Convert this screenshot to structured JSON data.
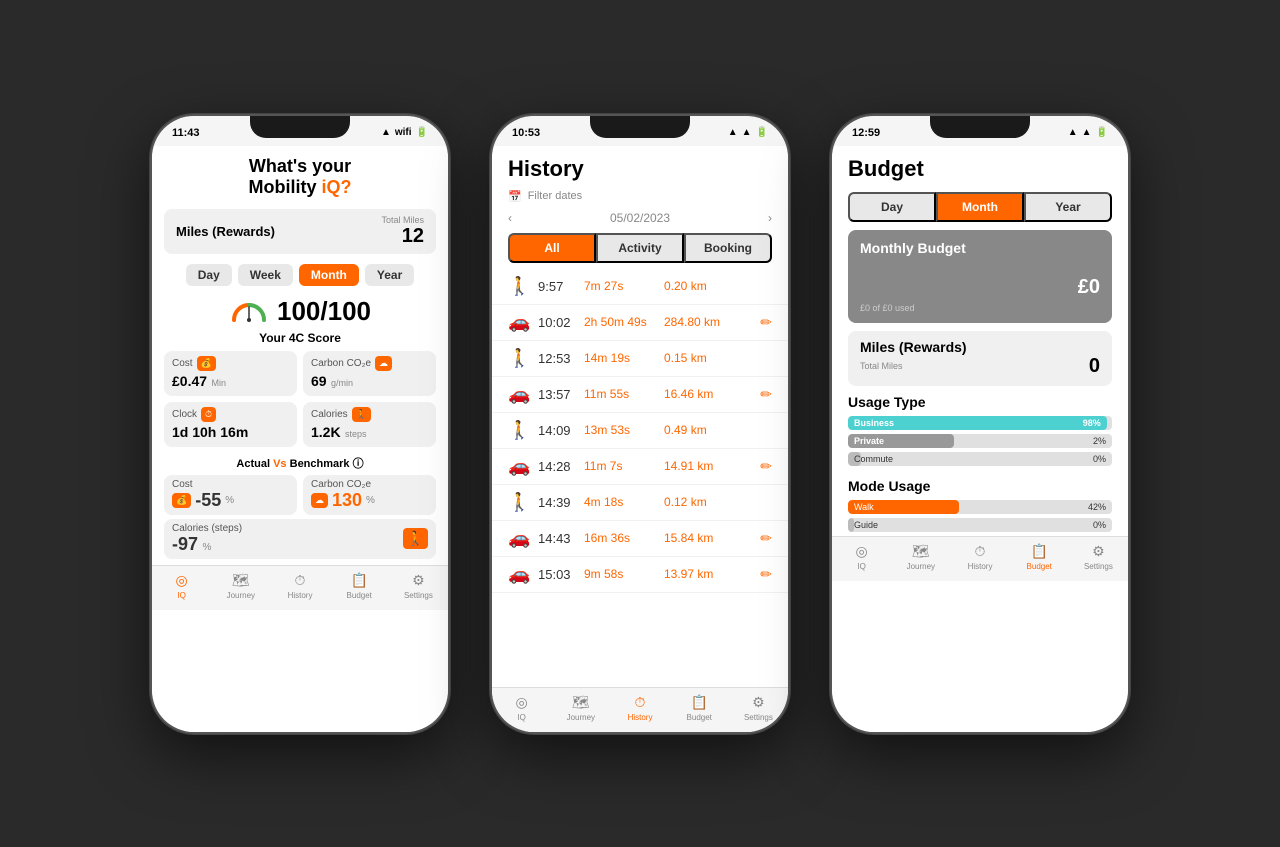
{
  "background": "#2a2a2a",
  "phones": [
    {
      "id": "iq",
      "status_time": "11:43",
      "title_line1": "What's your",
      "title_line2": "Mobility ",
      "title_highlight": "iQ?",
      "miles_label": "Miles (Rewards)",
      "total_miles_label": "Total Miles",
      "miles_value": "12",
      "period_tabs": [
        "Day",
        "Week",
        "Month",
        "Year"
      ],
      "active_period": "Month",
      "score": "100/100",
      "your_4c": "Your 4C Score",
      "cost_label": "Cost",
      "cost_value": "£0.47",
      "cost_unit": "Min",
      "carbon_label": "Carbon CO₂e",
      "carbon_value": "69",
      "carbon_unit": "g/min",
      "clock_label": "Clock",
      "clock_value": "1d 10h 16m",
      "calories_label": "Calories",
      "calories_value": "1.2K",
      "calories_unit": "steps",
      "actual_vs": "Actual Vs Benchmark",
      "bench_cost_label": "Cost",
      "bench_cost_value": "-55",
      "bench_cost_unit": "%",
      "bench_carbon_label": "Carbon CO₂e",
      "bench_carbon_value": "130",
      "bench_carbon_unit": "%",
      "bench_calories_label": "Calories (steps)",
      "bench_calories_value": "-97",
      "bench_calories_unit": "%",
      "nav": [
        "IQ",
        "Journey",
        "History",
        "Budget",
        "Settings"
      ],
      "active_nav": 0
    },
    {
      "id": "history",
      "status_time": "10:53",
      "title": "History",
      "filter_label": "Filter dates",
      "date": "05/02/2023",
      "filter_tabs": [
        "All",
        "Activity",
        "Booking"
      ],
      "active_filter": "All",
      "items": [
        {
          "icon": "walk",
          "time": "9:57",
          "duration": "7m 27s",
          "distance": "0.20 km",
          "edit": false
        },
        {
          "icon": "car",
          "time": "10:02",
          "duration": "2h 50m 49s",
          "distance": "284.80 km",
          "edit": true
        },
        {
          "icon": "walk",
          "time": "12:53",
          "duration": "14m 19s",
          "distance": "0.15 km",
          "edit": false
        },
        {
          "icon": "car",
          "time": "13:57",
          "duration": "11m 55s",
          "distance": "16.46 km",
          "edit": true
        },
        {
          "icon": "walk",
          "time": "14:09",
          "duration": "13m 53s",
          "distance": "0.49 km",
          "edit": false
        },
        {
          "icon": "car",
          "time": "14:28",
          "duration": "11m 7s",
          "distance": "14.91 km",
          "edit": true
        },
        {
          "icon": "walk",
          "time": "14:39",
          "duration": "4m 18s",
          "distance": "0.12 km",
          "edit": false
        },
        {
          "icon": "car",
          "time": "14:43",
          "duration": "16m 36s",
          "distance": "15.84 km",
          "edit": true
        },
        {
          "icon": "car",
          "time": "15:03",
          "duration": "9m 58s",
          "distance": "13.97 km",
          "edit": true
        }
      ],
      "nav": [
        "IQ",
        "Journey",
        "History",
        "Budget",
        "Settings"
      ],
      "active_nav": 2
    },
    {
      "id": "budget",
      "status_time": "12:59",
      "title": "Budget",
      "period_tabs": [
        "Day",
        "Month",
        "Year"
      ],
      "active_period": "Month",
      "monthly_budget_title": "Monthly Budget",
      "monthly_budget_value": "£0",
      "monthly_budget_sub": "£0 of £0 used",
      "miles_rewards_label": "Miles (Rewards)",
      "miles_rewards_total": "Total Miles",
      "miles_rewards_value": "0",
      "usage_type_title": "Usage Type",
      "usage_bars": [
        {
          "label": "Business",
          "pct": 98,
          "color": "#4dd0d0",
          "pct_label": "98%"
        },
        {
          "label": "Private",
          "pct": 2,
          "color": "#888",
          "pct_label": "2%"
        },
        {
          "label": "Commute",
          "pct": 0,
          "color": "#888",
          "pct_label": "0%"
        }
      ],
      "mode_usage_title": "Mode Usage",
      "mode_bars": [
        {
          "label": "Walk",
          "pct": 42,
          "color": "#ff6600",
          "pct_label": "42%"
        },
        {
          "label": "Guide",
          "pct": 0,
          "color": "#888",
          "pct_label": "0%"
        }
      ],
      "nav": [
        "IQ",
        "Journey",
        "History",
        "Budget",
        "Settings"
      ],
      "active_nav": 3
    }
  ]
}
